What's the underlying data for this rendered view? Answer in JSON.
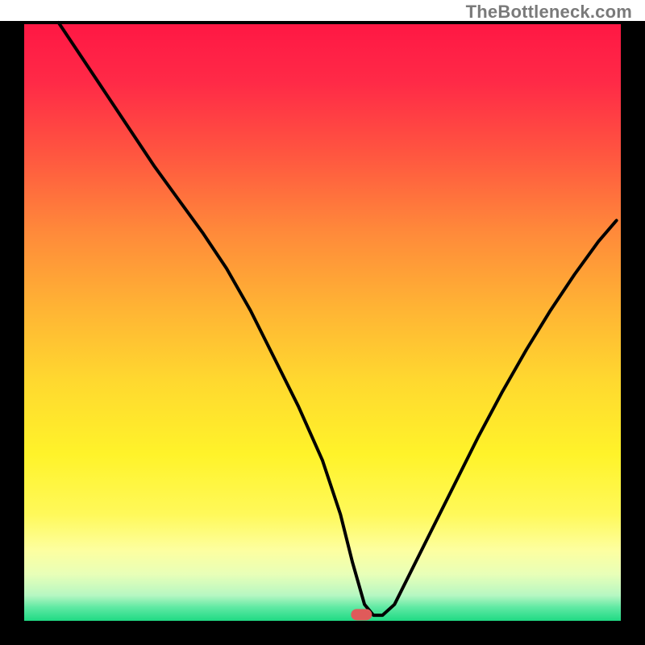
{
  "watermark": "TheBottleneck.com",
  "chart_data": {
    "type": "line",
    "title": "",
    "xlabel": "",
    "ylabel": "",
    "xlim": [
      0,
      100
    ],
    "ylim": [
      0,
      100
    ],
    "grid": false,
    "legend": false,
    "marker": {
      "x": 56.5,
      "y": 1.3,
      "color": "#e05a5a",
      "shape": "pill"
    },
    "series": [
      {
        "name": "bottleneck-curve",
        "color": "#000000",
        "x": [
          6,
          10,
          14,
          18,
          22,
          26,
          30,
          34,
          38,
          42,
          46,
          50,
          53,
          55,
          57,
          58.5,
          60,
          62,
          64,
          68,
          72,
          76,
          80,
          84,
          88,
          92,
          96,
          99
        ],
        "y": [
          100,
          94,
          88,
          82,
          76,
          70.5,
          65,
          59,
          52,
          44,
          36,
          27,
          18,
          10,
          3,
          1.2,
          1.2,
          3,
          7,
          15,
          23,
          31,
          38.5,
          45.5,
          52,
          58,
          63.5,
          67
        ]
      }
    ],
    "background_gradient": {
      "stops": [
        {
          "offset": 0.0,
          "color": "#ff1744"
        },
        {
          "offset": 0.1,
          "color": "#ff2a47"
        },
        {
          "offset": 0.22,
          "color": "#ff5640"
        },
        {
          "offset": 0.35,
          "color": "#ff8a3a"
        },
        {
          "offset": 0.48,
          "color": "#ffb534"
        },
        {
          "offset": 0.6,
          "color": "#ffd92f"
        },
        {
          "offset": 0.72,
          "color": "#fff32a"
        },
        {
          "offset": 0.82,
          "color": "#fff95a"
        },
        {
          "offset": 0.88,
          "color": "#fdffa0"
        },
        {
          "offset": 0.92,
          "color": "#e8ffb8"
        },
        {
          "offset": 0.955,
          "color": "#b6f7c2"
        },
        {
          "offset": 0.975,
          "color": "#5fe9a3"
        },
        {
          "offset": 1.0,
          "color": "#18d880"
        }
      ]
    },
    "plot_border": "#000000"
  }
}
